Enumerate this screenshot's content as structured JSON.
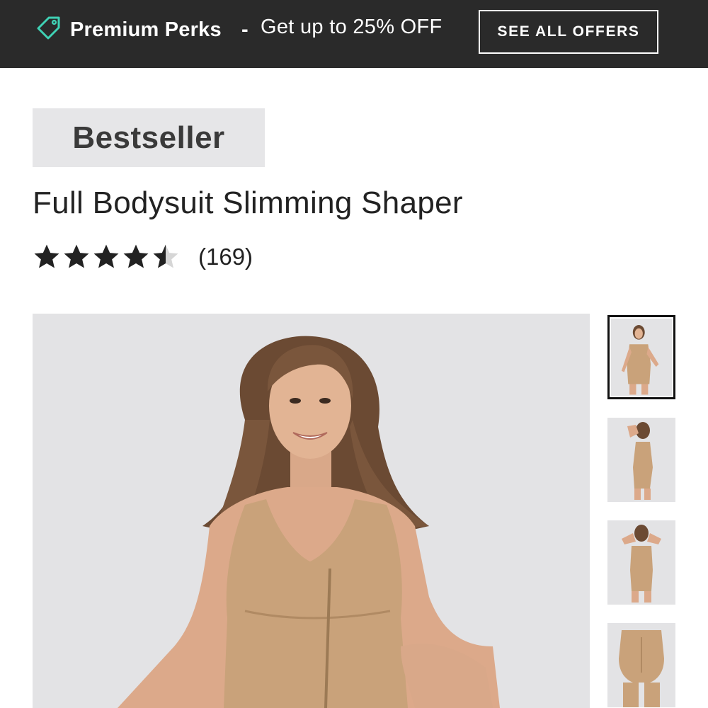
{
  "promo": {
    "icon": "tag-icon",
    "title": "Premium Perks",
    "separator": "-",
    "offer_text": "Get up to 25% OFF",
    "cta_label": "SEE ALL OFFERS",
    "accent_color": "#3fd1b4"
  },
  "product": {
    "badge": "Bestseller",
    "title": "Full Bodysuit Slimming Shaper",
    "rating": {
      "value": 4.5,
      "max": 5,
      "count_label": "(169)"
    },
    "colors": {
      "shaper": "#c9a27a",
      "image_bg": "#e3e3e5"
    }
  },
  "gallery": {
    "main_image": "model-front-smiling",
    "thumbnails": [
      {
        "name": "full-front",
        "active": true
      },
      {
        "name": "side-pose",
        "active": false
      },
      {
        "name": "front-arms-up",
        "active": false
      },
      {
        "name": "rear-view",
        "active": false
      }
    ]
  }
}
